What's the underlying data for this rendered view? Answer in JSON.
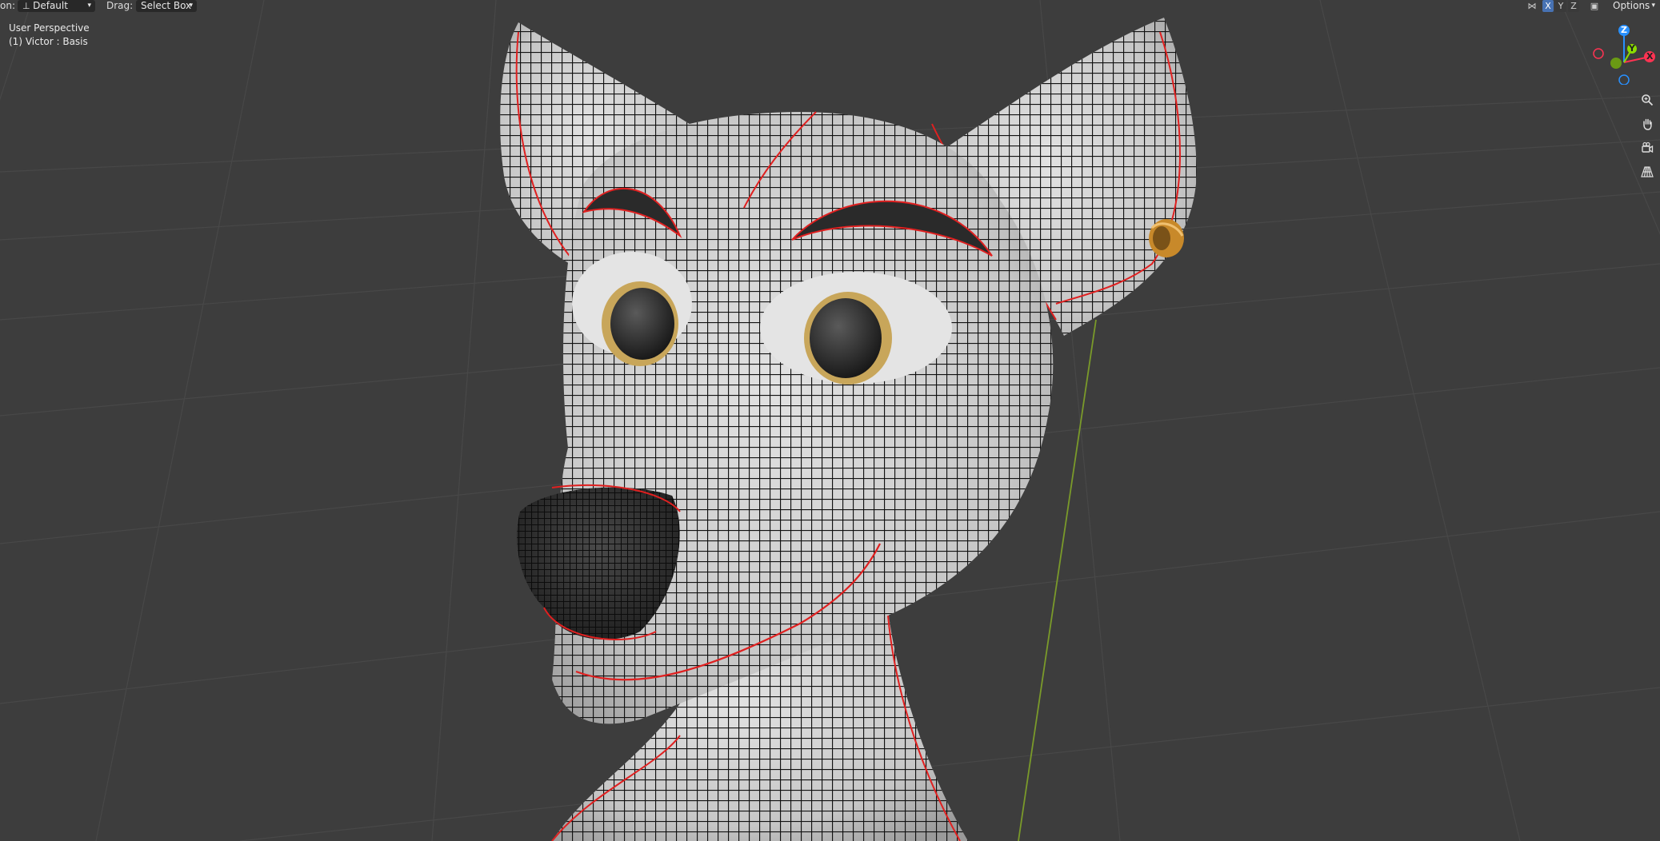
{
  "header": {
    "orientation_label": "on:",
    "orientation_value": "Default",
    "drag_label": "Drag:",
    "drag_value": "Select Box",
    "axis_x": "X",
    "axis_y": "Y",
    "axis_z": "Z",
    "options_label": "Options"
  },
  "viewport": {
    "view_name": "User Perspective",
    "object_info": "(1) Victor : Basis"
  },
  "gizmo": {
    "x_label": "X",
    "y_label": "Y",
    "z_label": "Z",
    "colors": {
      "x": "#ff3352",
      "y": "#8bdc00",
      "z": "#2890ff"
    }
  },
  "nav_icons": [
    "zoom-icon",
    "pan-hand-icon",
    "camera-view-icon",
    "perspective-grid-icon"
  ],
  "colors": {
    "background": "#3d3d3d",
    "grid": "#484848",
    "mesh_surface": "#cfcfcf",
    "wire": "#111111",
    "seam": "#e02020",
    "iris": "#c8a65a",
    "earring": "#c8892a",
    "y_axis_line": "#7a9a2a",
    "active_axis": "#4772b3"
  }
}
